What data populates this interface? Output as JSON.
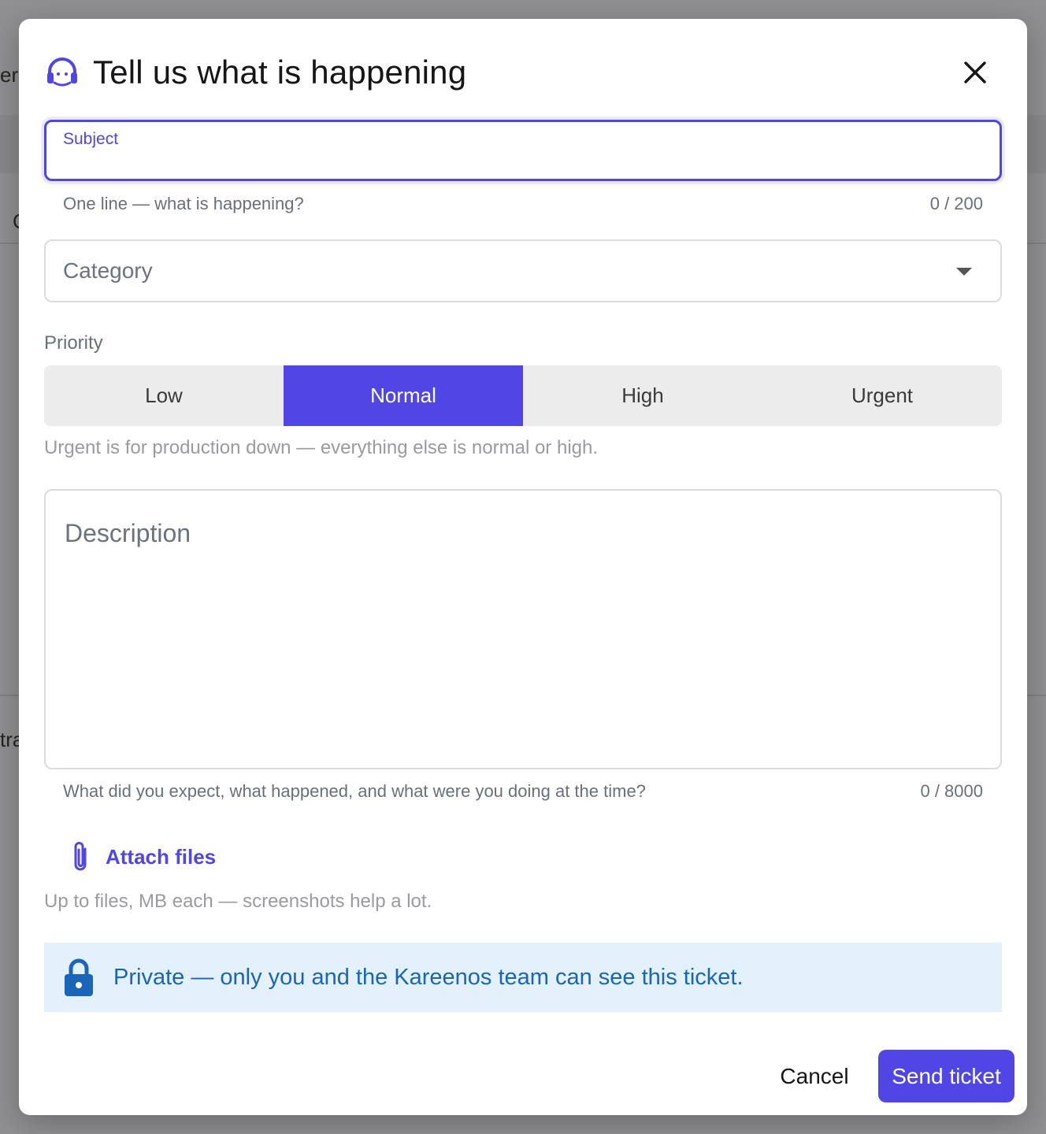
{
  "background": {
    "fragment_top": "er",
    "fragment_mid": "C",
    "fragment_bottom": "tra"
  },
  "modal": {
    "title": "Tell us what is happening",
    "header_icon": "headset-icon",
    "close_icon": "close-icon"
  },
  "subject": {
    "label": "Subject",
    "value": "",
    "helper": "One line — what is happening?",
    "counter": "0 / 200"
  },
  "category": {
    "placeholder": "Category",
    "icon": "chevron-down-icon"
  },
  "priority": {
    "label": "Priority",
    "options": [
      "Low",
      "Normal",
      "High",
      "Urgent"
    ],
    "selected": "Normal",
    "hint": "Urgent is for production down — everything else is normal or high."
  },
  "description": {
    "placeholder": "Description",
    "value": "",
    "helper": "What did you expect, what happened, and what were you doing at the time?",
    "counter": "0 / 8000"
  },
  "attach": {
    "label": "Attach files",
    "icon": "paperclip-icon",
    "hint": "Up to files, MB each — screenshots help a lot."
  },
  "notice": {
    "icon": "lock-icon",
    "text": "Private — only you and the Kareenos team can see this ticket."
  },
  "footer": {
    "cancel_label": "Cancel",
    "send_label": "Send ticket"
  },
  "colors": {
    "accent": "#4f46e5",
    "notice_bg": "#e3f1fc",
    "notice_text": "#1a65b8"
  }
}
